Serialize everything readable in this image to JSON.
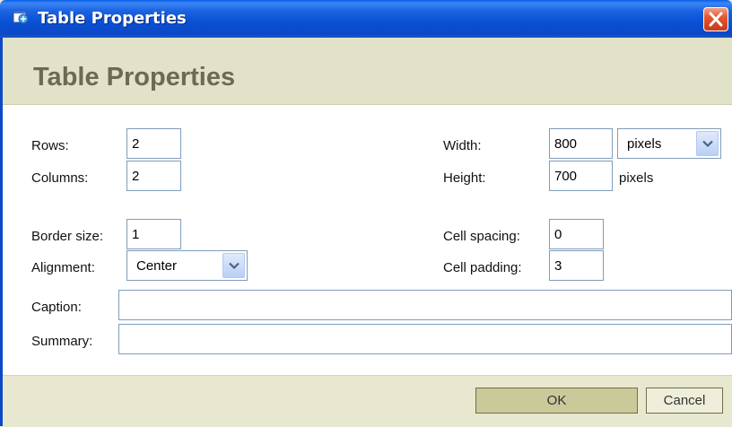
{
  "window": {
    "title": "Table Properties",
    "close_icon": "close-icon",
    "app_icon": "dialog-icon"
  },
  "header": {
    "title": "Table Properties"
  },
  "form": {
    "rows": {
      "label": "Rows:",
      "value": "2"
    },
    "columns": {
      "label": "Columns:",
      "value": "2"
    },
    "border_size": {
      "label": "Border size:",
      "value": "1"
    },
    "alignment": {
      "label": "Alignment:",
      "selected": "Center"
    },
    "width": {
      "label": "Width:",
      "value": "800",
      "unit_selected": "pixels"
    },
    "height": {
      "label": "Height:",
      "value": "700",
      "unit": "pixels"
    },
    "cell_spacing": {
      "label": "Cell spacing:",
      "value": "0"
    },
    "cell_padding": {
      "label": "Cell padding:",
      "value": "3"
    },
    "caption": {
      "label": "Caption:",
      "value": ""
    },
    "summary": {
      "label": "Summary:",
      "value": ""
    }
  },
  "buttons": {
    "ok": "OK",
    "cancel": "Cancel"
  },
  "colors": {
    "titlebar": "#0a4fd4",
    "header_band": "#e2e2c8",
    "header_text": "#6b6b52",
    "ok_button": "#c9c99a",
    "close_button": "#e4572d"
  }
}
